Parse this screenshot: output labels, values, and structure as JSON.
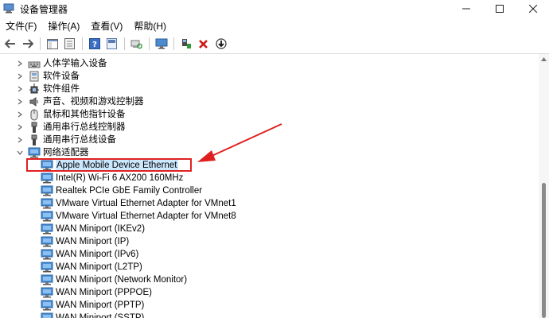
{
  "window": {
    "title": "设备管理器"
  },
  "menu": [
    {
      "label": "文件(F)"
    },
    {
      "label": "操作(A)"
    },
    {
      "label": "查看(V)"
    },
    {
      "label": "帮助(H)"
    }
  ],
  "tree": {
    "categories": [
      {
        "label": "人体学输入设备",
        "icon": "hid-icon"
      },
      {
        "label": "软件设备",
        "icon": "software-device-icon"
      },
      {
        "label": "软件组件",
        "icon": "software-component-icon"
      },
      {
        "label": "声音、视频和游戏控制器",
        "icon": "speaker-icon"
      },
      {
        "label": "鼠标和其他指针设备",
        "icon": "mouse-icon"
      },
      {
        "label": "通用串行总线控制器",
        "icon": "usb-icon"
      },
      {
        "label": "通用串行总线设备",
        "icon": "usb-icon"
      },
      {
        "label": "网络适配器",
        "icon": "network-adapter-icon",
        "expanded": true
      }
    ],
    "network_adapters": [
      {
        "label": "Apple Mobile Device Ethernet",
        "selected": true
      },
      {
        "label": "Intel(R) Wi-Fi 6 AX200 160MHz"
      },
      {
        "label": "Realtek PCIe GbE Family Controller"
      },
      {
        "label": "VMware Virtual Ethernet Adapter for VMnet1"
      },
      {
        "label": "VMware Virtual Ethernet Adapter for VMnet8"
      },
      {
        "label": "WAN Miniport (IKEv2)"
      },
      {
        "label": "WAN Miniport (IP)"
      },
      {
        "label": "WAN Miniport (IPv6)"
      },
      {
        "label": "WAN Miniport (L2TP)"
      },
      {
        "label": "WAN Miniport (Network Monitor)"
      },
      {
        "label": "WAN Miniport (PPPOE)"
      },
      {
        "label": "WAN Miniport (PPTP)"
      },
      {
        "label": "WAN Miniport (SSTP)"
      }
    ]
  },
  "colors": {
    "annotation_red": "#e02020",
    "selection": "#cce8ff",
    "network_icon": "#3a86c8"
  }
}
